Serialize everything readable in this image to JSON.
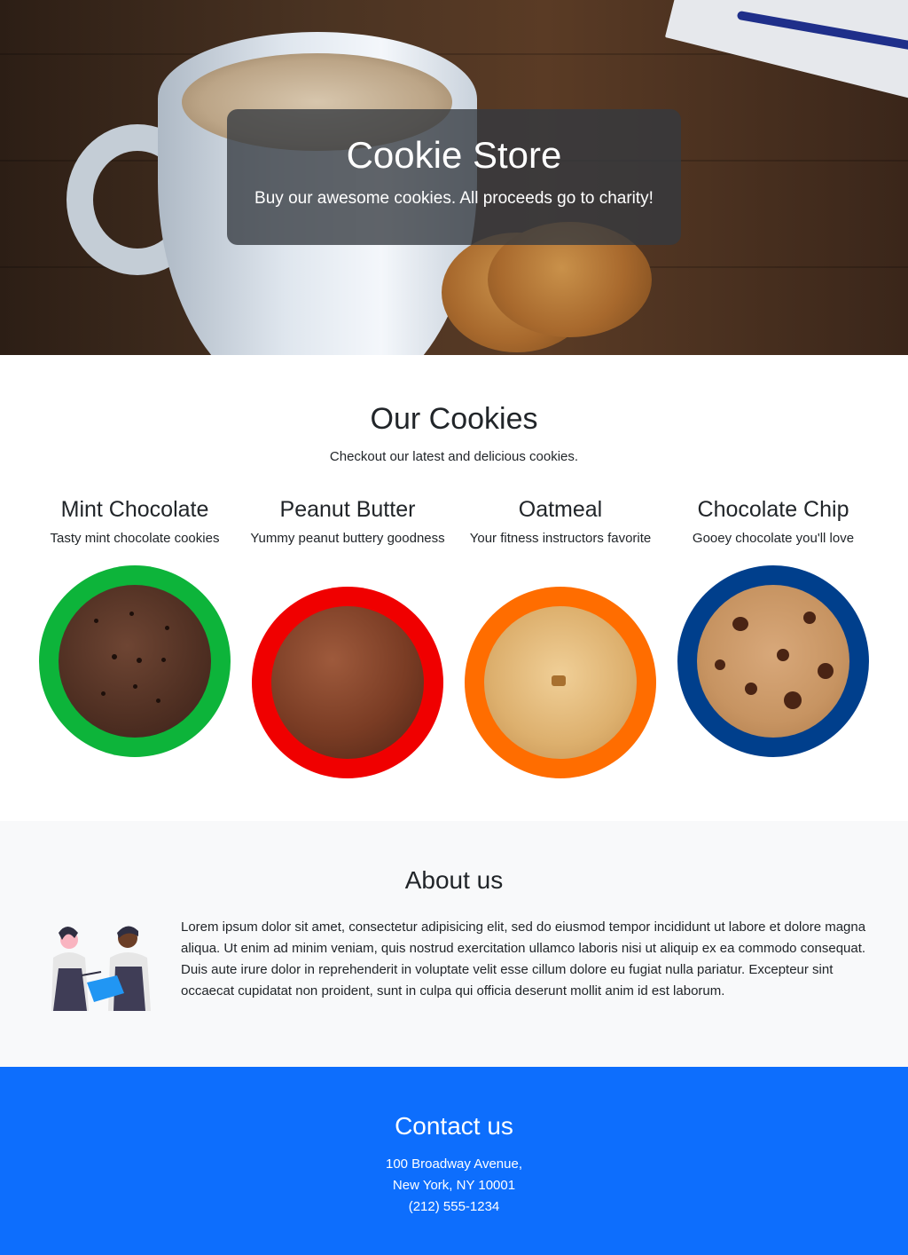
{
  "hero": {
    "title": "Cookie Store",
    "subtitle": "Buy our awesome cookies. All proceeds go to charity!"
  },
  "cookies_section": {
    "title": "Our Cookies",
    "subtitle": "Checkout our latest and delicious cookies.",
    "items": [
      {
        "name": "Mint Chocolate",
        "description": "Tasty mint chocolate cookies",
        "ring_color": "#0db43a"
      },
      {
        "name": "Peanut Butter",
        "description": "Yummy peanut buttery goodness",
        "ring_color": "#f00000"
      },
      {
        "name": "Oatmeal",
        "description": "Your fitness instructors favorite",
        "ring_color": "#ff6d00"
      },
      {
        "name": "Chocolate Chip",
        "description": "Gooey chocolate you'll love",
        "ring_color": "#003f8c"
      }
    ]
  },
  "about": {
    "title": "About us",
    "text": "Lorem ipsum dolor sit amet, consectetur adipisicing elit, sed do eiusmod tempor incididunt ut labore et dolore magna aliqua. Ut enim ad minim veniam, quis nostrud exercitation ullamco laboris nisi ut aliquip ex ea commodo consequat. Duis aute irure dolor in reprehenderit in voluptate velit esse cillum dolore eu fugiat nulla pariatur. Excepteur sint occaecat cupidatat non proident, sunt in culpa qui officia deserunt mollit anim id est laborum."
  },
  "contact": {
    "title": "Contact us",
    "address_line1": "100 Broadway Avenue,",
    "address_line2": "New York, NY 10001",
    "phone": "(212) 555-1234"
  },
  "colors": {
    "contact_background": "#0d6efd",
    "about_background": "#f8f9fa"
  }
}
